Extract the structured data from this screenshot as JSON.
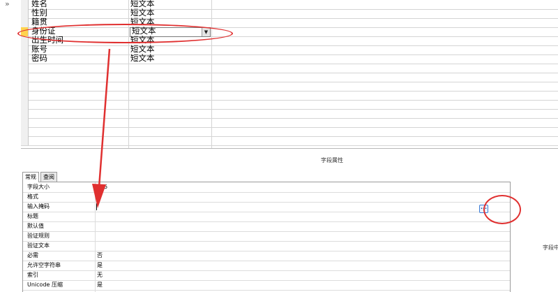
{
  "nav": {
    "chevron": "»"
  },
  "fields": [
    {
      "name": "姓名",
      "type": "短文本"
    },
    {
      "name": "性别",
      "type": "短文本"
    },
    {
      "name": "籍贯",
      "type": "短文本"
    },
    {
      "name": "身份证",
      "type": "短文本",
      "selected": true
    },
    {
      "name": "出生时间",
      "type": "短文本"
    },
    {
      "name": "账号",
      "type": "短文本"
    },
    {
      "name": "密码",
      "type": "短文本"
    }
  ],
  "properties_header": "字段属性",
  "tabs": [
    {
      "label": "常规",
      "active": true
    },
    {
      "label": "查阅",
      "active": false
    }
  ],
  "properties": [
    {
      "name": "字段大小",
      "value": "255"
    },
    {
      "name": "格式",
      "value": ""
    },
    {
      "name": "输入掩码",
      "value": ""
    },
    {
      "name": "标题",
      "value": ""
    },
    {
      "name": "默认值",
      "value": ""
    },
    {
      "name": "验证规则",
      "value": ""
    },
    {
      "name": "验证文本",
      "value": ""
    },
    {
      "name": "必需",
      "value": "否"
    },
    {
      "name": "允许空字符串",
      "value": "是"
    },
    {
      "name": "索引",
      "value": "无"
    },
    {
      "name": "Unicode 压缩",
      "value": "是"
    }
  ],
  "builder_button_label": "...",
  "right_note": "字段中",
  "colors": {
    "annotation": "#e03030",
    "selector_active": "#ffd34f"
  }
}
